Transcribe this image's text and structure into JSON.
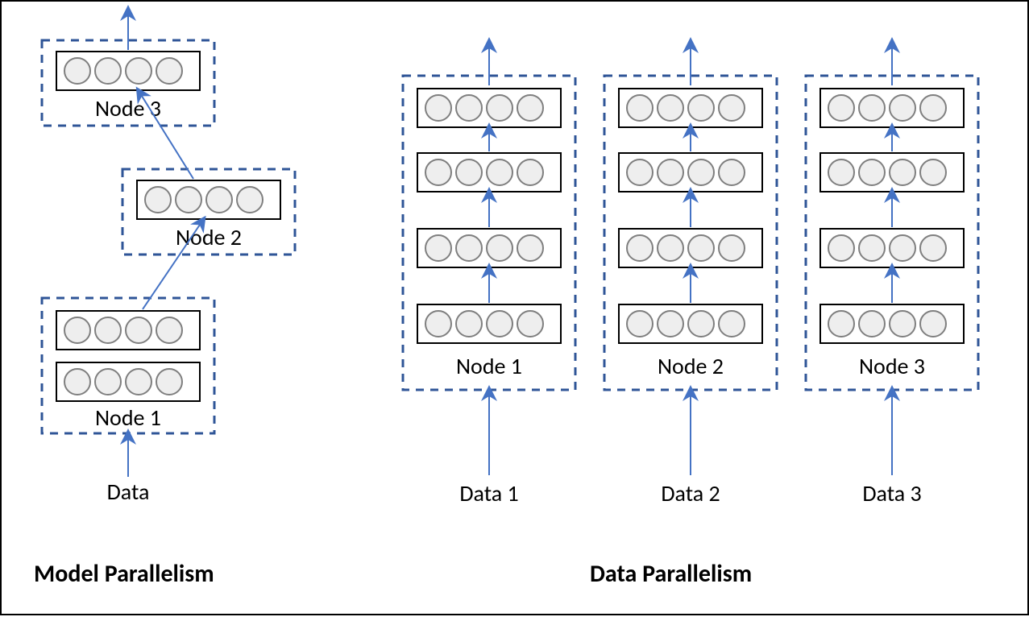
{
  "colors": {
    "dashed_stroke": "#2f5597",
    "arrow": "#4472c4",
    "neuron_fill": "#eeeeee",
    "neuron_stroke": "#7f7f7f"
  },
  "left": {
    "title": "Model Parallelism",
    "data_label": "Data",
    "nodes": [
      "Node 1",
      "Node 2",
      "Node 3"
    ]
  },
  "right": {
    "title": "Data Parallelism",
    "columns": [
      {
        "node": "Node 1",
        "data": "Data 1"
      },
      {
        "node": "Node 2",
        "data": "Data 2"
      },
      {
        "node": "Node 3",
        "data": "Data 3"
      }
    ]
  },
  "layers_per_column": 4,
  "neurons_per_layer": 4
}
